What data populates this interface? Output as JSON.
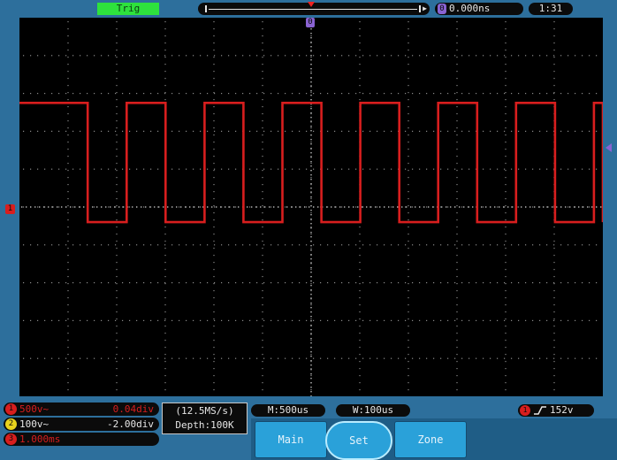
{
  "top_bar": {
    "trig_status": "Trig",
    "trigger_delay": "0.000ns",
    "clock": "1:31",
    "trigger_marker": "0",
    "trigger_position_marker": "0"
  },
  "waveform": {
    "channel_marker": "1",
    "color": "#d81e1e",
    "high_level": 0.225,
    "low_level": 0.54,
    "period": 0.1335,
    "first_rise": 0.117,
    "duty": 0.5,
    "dots_color": "#8a8a8a"
  },
  "status": {
    "ch1": {
      "badge": "1",
      "a": "500v~",
      "b": "0.04div"
    },
    "ch2": {
      "badge": "2",
      "a": "100v~",
      "b": "-2.00div"
    },
    "math": {
      "badge": "3",
      "a": "1.000ms"
    },
    "sample_rate": "(12.5MS/s)",
    "depth": "Depth:100K",
    "main_timebase": "M:500us",
    "window_timebase": "W:100us",
    "trigger_channel": "1",
    "trigger_level": "152v"
  },
  "menu": {
    "items": [
      "Main",
      "Set",
      "Zone"
    ]
  },
  "colors": {
    "background": "#2d6f9c",
    "trig_green": "#2ee23d",
    "ch1_red": "#d81e1e",
    "ch2_yellow": "#e8d21d",
    "marker_purple": "#8a63d2",
    "menu_blue": "#2aa1d9"
  }
}
